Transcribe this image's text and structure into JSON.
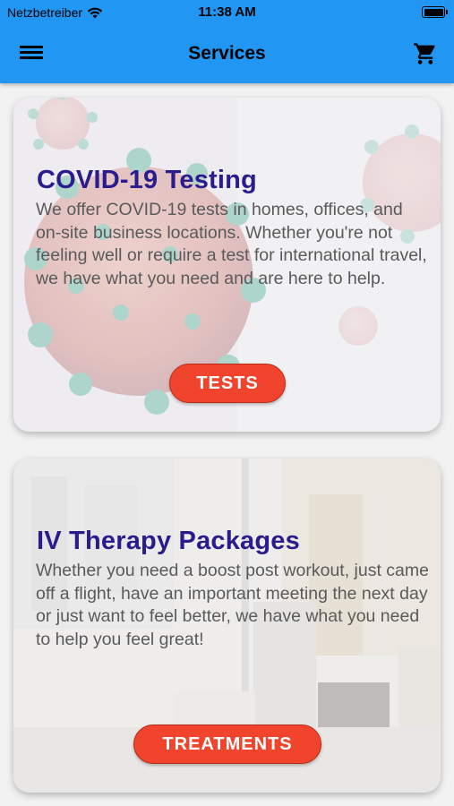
{
  "status_bar": {
    "carrier": "Netzbetreiber",
    "time": "11:38 AM"
  },
  "header": {
    "title": "Services"
  },
  "cards": [
    {
      "title": "COVID-19 Testing",
      "description": "We offer COVID-19 tests in homes, offices, and on-site business locations. Whether you're not feeling well or require a test for international travel, we have what you need and are here to help.",
      "button_label": "TESTS"
    },
    {
      "title": "IV Therapy Packages",
      "description": "Whether you need a boost post workout, just came off a flight, have an important meeting the next day or just want to feel better, we have what you need to help you feel great!",
      "button_label": "TREATMENTS"
    }
  ],
  "icons": {
    "menu": "hamburger-menu-icon",
    "cart": "shopping-cart-icon",
    "wifi": "wifi-icon",
    "battery": "battery-icon"
  },
  "colors": {
    "app_bar": "#2196f3",
    "title": "#2a1c8c",
    "button": "#f0442d"
  }
}
